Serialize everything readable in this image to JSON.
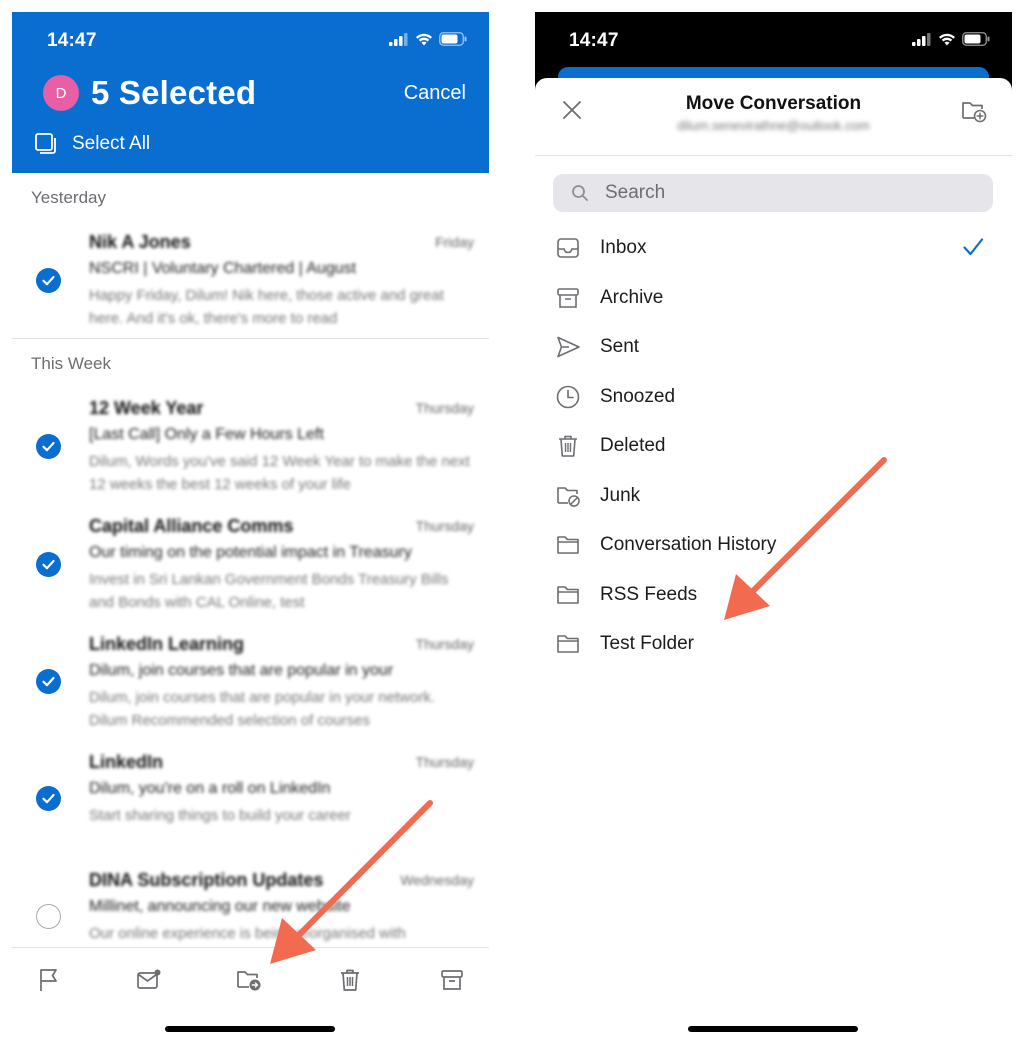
{
  "accent_color": "#0a6ed1",
  "arrow_color": "#f26a4f",
  "left": {
    "status_time": "14:47",
    "avatar_initial": "D",
    "selection_title": "5 Selected",
    "cancel_label": "Cancel",
    "select_all_label": "Select All",
    "sections": {
      "yesterday": "Yesterday",
      "this_week": "This Week"
    },
    "messages": [
      {
        "sender": "Nik A Jones",
        "date": "Friday",
        "subject": "NSCRI | Voluntary Chartered | August",
        "preview": "Happy Friday, Dilum! Nik here, those active and great here. And it's ok, there's more to read",
        "selected": true
      },
      {
        "sender": "12 Week Year",
        "date": "Thursday",
        "subject": "[Last Call] Only a Few Hours Left",
        "preview": "Dilum, Words you've said 12 Week Year to make the next 12 weeks the best 12 weeks of your life",
        "selected": true
      },
      {
        "sender": "Capital Alliance Comms",
        "date": "Thursday",
        "subject": "Our timing on the potential impact in Treasury",
        "preview": "Invest in Sri Lankan Government Bonds Treasury Bills and Bonds with CAL Online, test",
        "selected": true
      },
      {
        "sender": "LinkedIn Learning",
        "date": "Thursday",
        "subject": "Dilum, join courses that are popular in your",
        "preview": "Dilum, join courses that are popular in your network. Dilum Recommended selection of courses",
        "selected": true
      },
      {
        "sender": "LinkedIn",
        "date": "Thursday",
        "subject": "Dilum, you're on a roll on LinkedIn",
        "preview": "Start sharing things to build your career",
        "selected": true
      },
      {
        "sender": "DINA Subscription Updates",
        "date": "Wednesday",
        "subject": "Millinet, announcing our new website",
        "preview": "Our online experience is being reorganised with",
        "selected": false
      }
    ],
    "toolbar": [
      "flag-icon",
      "mark-read-icon",
      "move-folder-icon",
      "trash-icon",
      "archive-icon"
    ]
  },
  "right": {
    "status_time": "14:47",
    "sheet_title": "Move Conversation",
    "sheet_subtitle": "dilum.senevirathne@outlook.com",
    "search_placeholder": "Search",
    "folders": [
      {
        "label": "Inbox",
        "icon": "inbox-icon",
        "checked": true
      },
      {
        "label": "Archive",
        "icon": "archive-icon",
        "checked": false
      },
      {
        "label": "Sent",
        "icon": "send-icon",
        "checked": false
      },
      {
        "label": "Snoozed",
        "icon": "clock-icon",
        "checked": false
      },
      {
        "label": "Deleted",
        "icon": "trash-icon",
        "checked": false
      },
      {
        "label": "Junk",
        "icon": "junk-folder-icon",
        "checked": false
      },
      {
        "label": "Conversation History",
        "icon": "folder-icon",
        "checked": false
      },
      {
        "label": "RSS Feeds",
        "icon": "folder-icon",
        "checked": false
      },
      {
        "label": "Test Folder",
        "icon": "folder-icon",
        "checked": false
      }
    ]
  }
}
